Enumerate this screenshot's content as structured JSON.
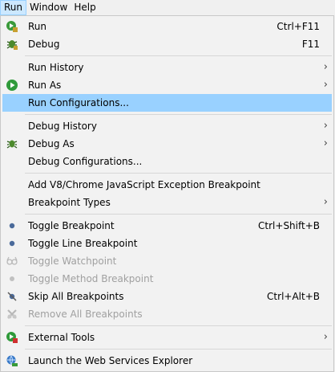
{
  "menubar": {
    "items": [
      {
        "label": "Run"
      },
      {
        "label": "Window"
      },
      {
        "label": "Help"
      }
    ]
  },
  "menu": {
    "run": {
      "label": "Run",
      "shortcut": "Ctrl+F11"
    },
    "debug": {
      "label": "Debug",
      "shortcut": "F11"
    },
    "run_history": {
      "label": "Run History"
    },
    "run_as": {
      "label": "Run As"
    },
    "run_configurations": {
      "label": "Run Configurations..."
    },
    "debug_history": {
      "label": "Debug History"
    },
    "debug_as": {
      "label": "Debug As"
    },
    "debug_configurations": {
      "label": "Debug Configurations..."
    },
    "add_breakpoint": {
      "label": "Add V8/Chrome JavaScript Exception Breakpoint"
    },
    "breakpoint_types": {
      "label": "Breakpoint Types"
    },
    "toggle_breakpoint": {
      "label": "Toggle Breakpoint",
      "shortcut": "Ctrl+Shift+B"
    },
    "toggle_line_breakpoint": {
      "label": "Toggle Line Breakpoint"
    },
    "toggle_watchpoint": {
      "label": "Toggle Watchpoint"
    },
    "toggle_method_breakpoint": {
      "label": "Toggle Method Breakpoint"
    },
    "skip_all_breakpoints": {
      "label": "Skip All Breakpoints",
      "shortcut": "Ctrl+Alt+B"
    },
    "remove_all_breakpoints": {
      "label": "Remove All Breakpoints"
    },
    "external_tools": {
      "label": "External Tools"
    },
    "launch_ws_explorer": {
      "label": "Launch the Web Services Explorer"
    }
  },
  "submenu_arrow": "›",
  "colors": {
    "highlight": "#99d1ff",
    "active_menubar": "#cce8ff",
    "disabled_text": "#a0a0a0"
  }
}
